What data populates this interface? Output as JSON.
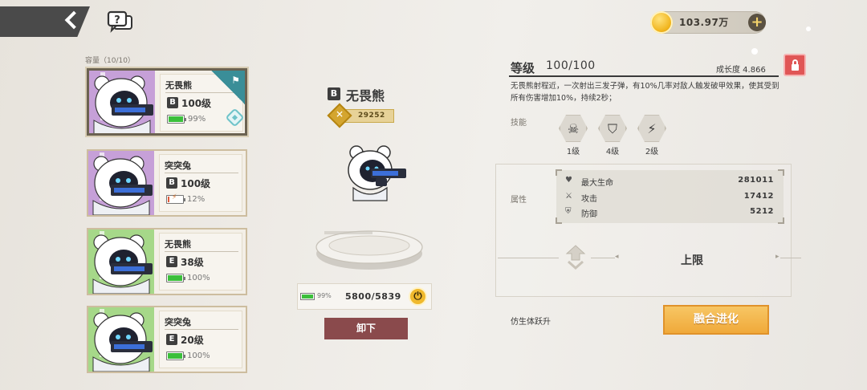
{
  "header": {
    "coins": "103.97万"
  },
  "squad": {
    "capacity_label": "容量（10/10）",
    "units": [
      {
        "name": "无畏熊",
        "grade": "B",
        "level": "100级",
        "energy": "99%",
        "energy_fraction": 0.99,
        "selected": true,
        "portrait_bg": "#c6a0d8",
        "low": false
      },
      {
        "name": "突突兔",
        "grade": "B",
        "level": "100级",
        "energy": "12%",
        "energy_fraction": 0.12,
        "selected": false,
        "portrait_bg": "#c6a0d8",
        "low": true
      },
      {
        "name": "无畏熊",
        "grade": "E",
        "level": "38级",
        "energy": "100%",
        "energy_fraction": 1.0,
        "selected": false,
        "portrait_bg": "#a6d889",
        "low": false
      },
      {
        "name": "突突兔",
        "grade": "E",
        "level": "20级",
        "energy": "100%",
        "energy_fraction": 1.0,
        "selected": false,
        "portrait_bg": "#a6d889",
        "low": false
      }
    ]
  },
  "detail": {
    "grade": "B",
    "name": "无畏熊",
    "power": "29252",
    "energy_pct": "99%",
    "energy": "5800/5839",
    "unload_label": "卸下"
  },
  "stats": {
    "level_label": "等级",
    "level_value": "100/100",
    "growth": "成长度 4.866",
    "description": "无畏熊射程近，一次射出三发子弹，有10%几率对敌人触发破甲效果，使其受到所有伤害增加10%，持续2秒；",
    "skills_label": "技能",
    "skills": [
      {
        "icon": "skull-icon",
        "glyph": "☠",
        "level": "1级"
      },
      {
        "icon": "shield-slash-icon",
        "glyph": "⛉",
        "level": "4级"
      },
      {
        "icon": "claw-icon",
        "glyph": "⚡",
        "level": "2级"
      }
    ],
    "attr_label": "属性",
    "attributes": [
      {
        "icon": "heart-icon",
        "glyph": "♥",
        "name": "最大生命",
        "value": "281011"
      },
      {
        "icon": "sword-icon",
        "glyph": "⚔",
        "name": "攻击",
        "value": "17412"
      },
      {
        "icon": "shield-icon",
        "glyph": "⛨",
        "name": "防御",
        "value": "5212"
      }
    ],
    "limit_label": "上限",
    "bio_label": "仿生体跃升",
    "fuse_label": "融合进化"
  },
  "colors": {
    "fuse_button": "#f0a93a",
    "unload_button": "#8a4a4c",
    "lock_button": "#e05656",
    "energy_green": "#3bbf3b",
    "selected_flag": "#3a8e98"
  }
}
